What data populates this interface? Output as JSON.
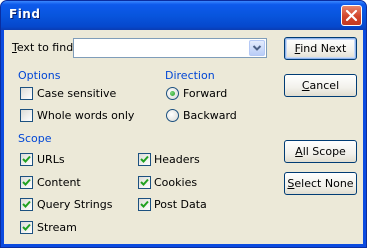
{
  "window": {
    "title": "Find"
  },
  "search": {
    "label_key": "T",
    "label_rest": "ext to find:",
    "value": ""
  },
  "options": {
    "label": "Options",
    "case_sensitive": {
      "label": "Case sensitive",
      "checked": false
    },
    "whole_words_only": {
      "label": "Whole words only",
      "checked": false
    }
  },
  "direction": {
    "label": "Direction",
    "forward": {
      "label": "Forward",
      "selected": true
    },
    "backward": {
      "label": "Backward",
      "selected": false
    }
  },
  "scope": {
    "label": "Scope",
    "items": [
      {
        "label": "URLs",
        "checked": true
      },
      {
        "label": "Content",
        "checked": true
      },
      {
        "label": "Query Strings",
        "checked": true
      },
      {
        "label": "Stream",
        "checked": true
      },
      {
        "label": "Headers",
        "checked": true
      },
      {
        "label": "Cookies",
        "checked": true
      },
      {
        "label": "Post Data",
        "checked": true
      }
    ]
  },
  "buttons": {
    "find_next": {
      "key": "F",
      "rest": "ind Next"
    },
    "cancel": {
      "key": "C",
      "rest": "ancel"
    },
    "all_scope": {
      "key": "A",
      "rest": "ll Scope"
    },
    "select_none": {
      "key": "S",
      "rest": "elect None"
    }
  },
  "colors": {
    "group_label": "#0046d5",
    "titlebar": "#0855dd",
    "dialog_bg": "#ece9d8"
  }
}
